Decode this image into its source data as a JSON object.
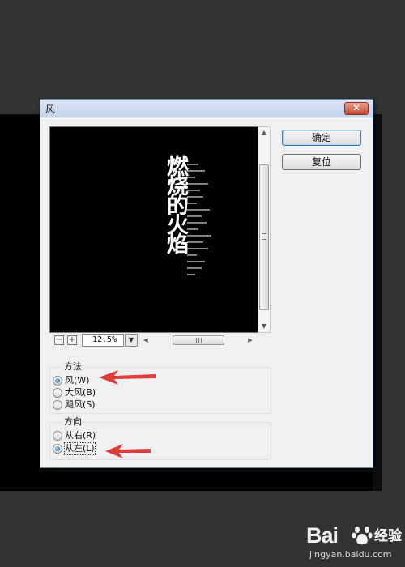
{
  "dialog": {
    "title": "风",
    "close_label": "✕"
  },
  "preview": {
    "text": "燃烧的火焰"
  },
  "zoom": {
    "minus": "−",
    "plus": "+",
    "value": "12.5%",
    "dropdown_glyph": "▼"
  },
  "buttons": {
    "ok_label": "确定",
    "reset_label": "复位"
  },
  "method": {
    "legend": "方法",
    "options": [
      {
        "label": "风(W)",
        "selected": true
      },
      {
        "label": "大风(B)",
        "selected": false
      },
      {
        "label": "飓风(S)",
        "selected": false
      }
    ]
  },
  "direction": {
    "legend": "方向",
    "options": [
      {
        "label": "从右(R)",
        "selected": false
      },
      {
        "label": "从左(L)",
        "selected": true
      }
    ]
  },
  "watermark": {
    "logo_text": "Bai",
    "logo_text2": "经验",
    "url": "jingyan.baidu.com"
  },
  "colors": {
    "annotation_arrow": "#e23b3b",
    "watermark_paw": "#f2f2f2"
  }
}
